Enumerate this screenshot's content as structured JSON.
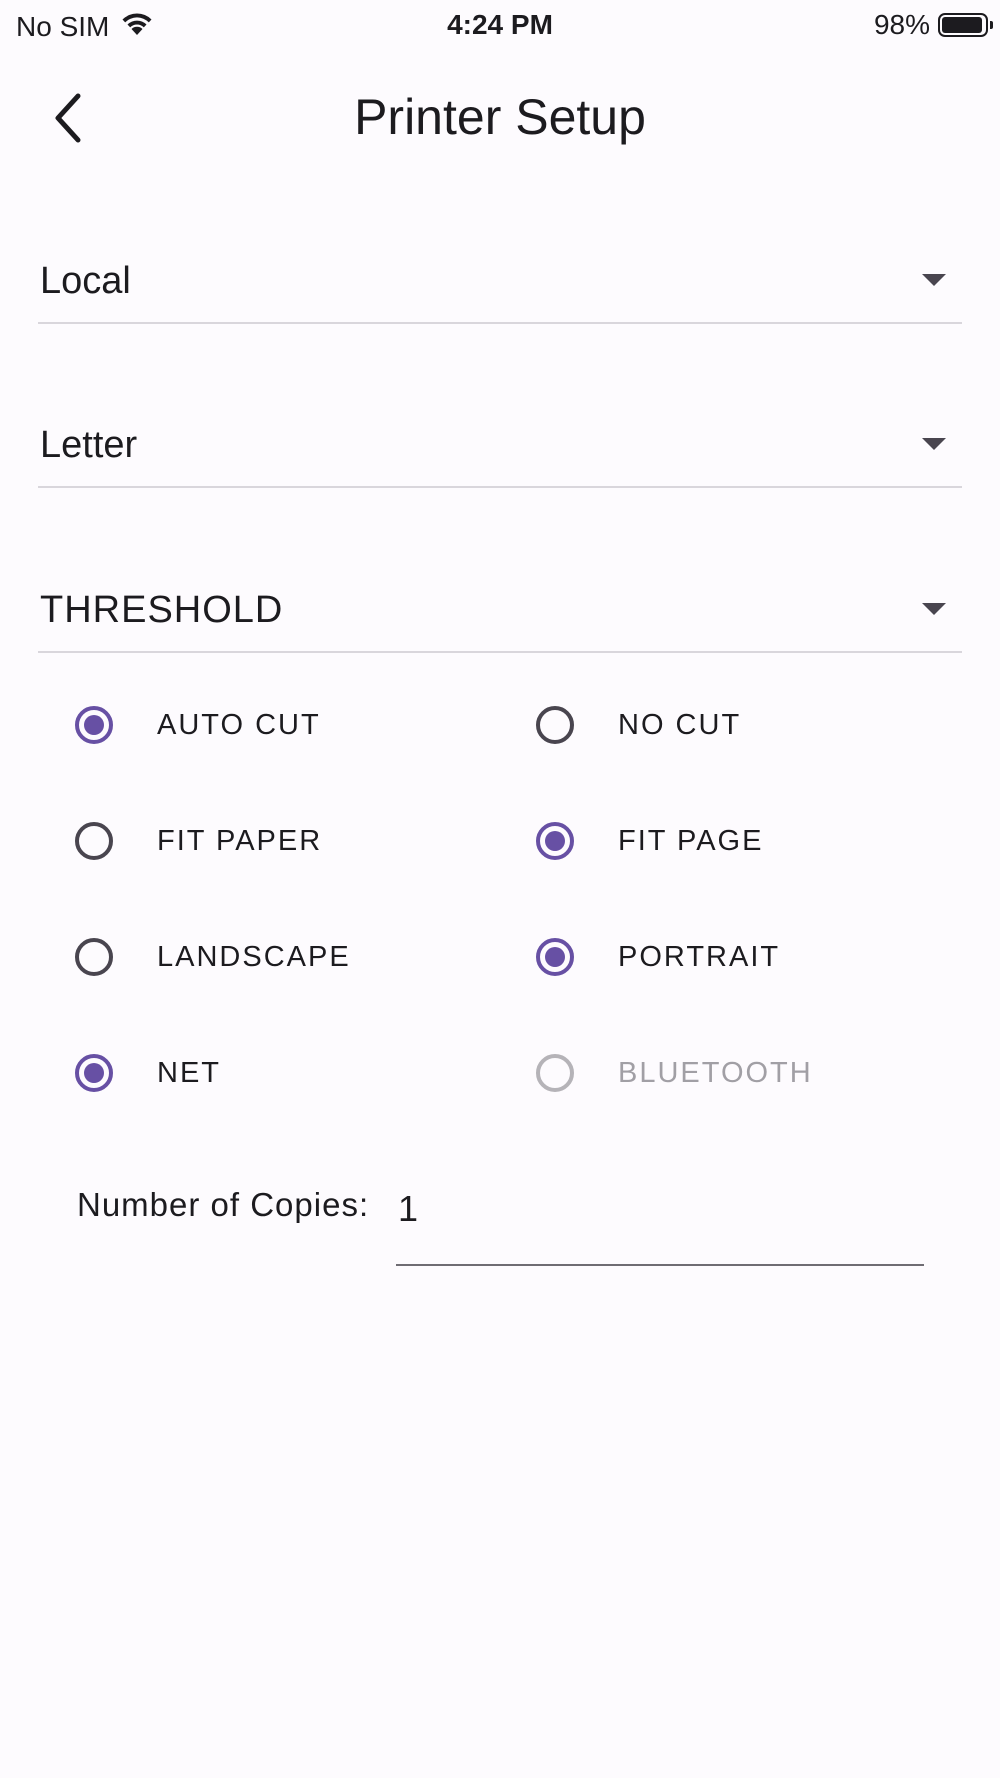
{
  "status_bar": {
    "carrier": "No SIM",
    "time": "4:24 PM",
    "battery_percent": "98%",
    "battery_level": 0.98,
    "wifi_icon": "wifi-icon",
    "battery_icon": "battery-icon"
  },
  "app_bar": {
    "title": "Printer Setup",
    "back_icon": "chevron-left-icon"
  },
  "dropdowns": {
    "connection": "Local",
    "paper_size": "Letter",
    "mode": "THRESHOLD"
  },
  "options": [
    {
      "label": "AUTO CUT",
      "checked": true,
      "disabled": false
    },
    {
      "label": "NO CUT",
      "checked": false,
      "disabled": false
    },
    {
      "label": "FIT PAPER",
      "checked": false,
      "disabled": false
    },
    {
      "label": "FIT PAGE",
      "checked": true,
      "disabled": false
    },
    {
      "label": "LANDSCAPE",
      "checked": false,
      "disabled": false
    },
    {
      "label": "PORTRAIT",
      "checked": true,
      "disabled": false
    },
    {
      "label": "NET",
      "checked": true,
      "disabled": false
    },
    {
      "label": "BLUETOOTH",
      "checked": false,
      "disabled": true
    }
  ],
  "copies": {
    "label": "Number of Copies:",
    "value": "1"
  },
  "colors": {
    "accent": "#6750a4",
    "background": "#fdfbfe",
    "text": "#1c1b1f",
    "disabled": "#a19fa5"
  }
}
